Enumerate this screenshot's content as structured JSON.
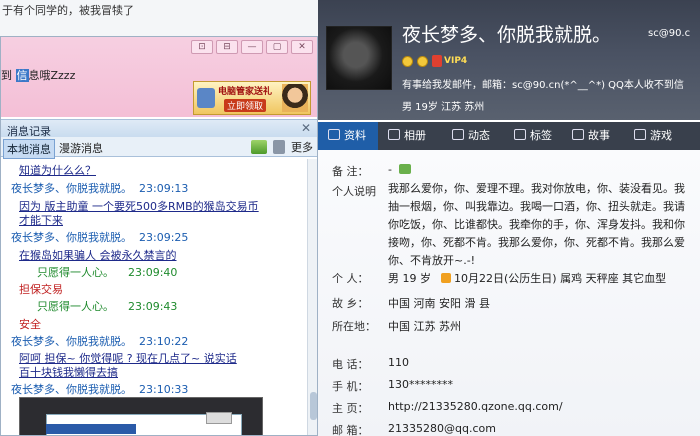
{
  "background_window": {
    "text": "于有个同学的，被我冒犊了"
  },
  "chat": {
    "window_buttons": [
      "⊡",
      "⊟",
      "—",
      "▢",
      "✕"
    ],
    "input_text_prefix": "到 ",
    "input_text_highlight": "信",
    "input_text_suffix": "息哦Zzzz",
    "ad": {
      "line1": "电脑管家送礼",
      "line2": "立即领取"
    }
  },
  "history": {
    "title": "消息记录",
    "close": "✕",
    "tab_local": "本地消息",
    "tab_roam": "漫游消息",
    "more": "更多",
    "messages": [
      {
        "type": "content",
        "text": "知道为什么么？"
      },
      {
        "type": "sender",
        "name": "夜长梦多、你脱我就脱。",
        "time": "23:09:13"
      },
      {
        "type": "content",
        "text": "因为    版主助童    一个要死500多RMB的猴岛交易币"
      },
      {
        "type": "content",
        "text": "才能下来"
      },
      {
        "type": "sender",
        "name": "夜长梦多、你脱我就脱。",
        "time": "23:09:25"
      },
      {
        "type": "content",
        "text": "在猴岛如果骗人    会被永久禁言的"
      },
      {
        "type": "me",
        "name": "只愿得一人心。",
        "time": "23:09:40"
      },
      {
        "type": "content2",
        "text": "担保交易"
      },
      {
        "type": "me",
        "name": "只愿得一人心。",
        "time": "23:09:43"
      },
      {
        "type": "content2",
        "text": "安全"
      },
      {
        "type": "sender",
        "name": "夜长梦多、你脱我就脱。",
        "time": "23:10:22"
      },
      {
        "type": "content",
        "text": "阿呵    担保~  你觉得呢  ?    现在几点了~  说实话"
      },
      {
        "type": "content",
        "text": "百十块钱我懒得去搞"
      },
      {
        "type": "sender",
        "name": "夜长梦多、你脱我就脱。",
        "time": "23:10:33"
      }
    ],
    "thumb": {
      "button": "搜索",
      "tab": "帐子"
    }
  },
  "profile": {
    "nickname": "夜长梦多、你脱我就脱。",
    "qq_partial": "sc@90.c",
    "vip": "VIP4",
    "signature": "有事给我发邮件，邮箱：sc@90.cn(*^__^*) QQ本人收不到信",
    "basic": "男    19岁    江苏 苏州",
    "tabs": [
      "资料",
      "相册",
      "动态",
      "标签",
      "故事",
      "游戏"
    ],
    "fields": {
      "note_label": "备    注：",
      "note_value": "-",
      "about_label": "个人说明",
      "about_text": "我那么爱你，你、爱理不理。我对你放电，你、装没看见。我抽一根烟，你、叫我靠边。我喝一口酒，你、扭头就走。我请你吃饭，你、比谁都快。我牵你的手，你、浑身发抖。我和你接吻，你、死都不肯。我那么爱你，你、死都不肯。我那么爱你、不肯放开~.-!",
      "person_label": "个    人：",
      "person_value_a": "男    19 岁",
      "person_value_b": "10月22日(公历生日)    属鸡    天秤座    其它血型",
      "hometown_label": "故    乡：",
      "hometown_value": "中国 河南 安阳 滑    县",
      "location_label": "所在地：",
      "location_value": "中国 江苏 苏州",
      "phone_label": "电    话：",
      "phone_value": "110",
      "mobile_label": "手    机：",
      "mobile_value": "130********",
      "home_label": "主    页：",
      "home_value": "http://21335280.qzone.qq.com/",
      "mail_label": "邮    箱：",
      "mail_value": "21335280@qq.com"
    }
  },
  "colors": {
    "profile_head": "#4a5263",
    "tab_active": "#1f5ea8",
    "chat_pink": "#f4bfd6",
    "sender_blue": "#1b5db0",
    "me_green": "#1e8a2c",
    "content_navy": "#1e2a8a",
    "content_red": "#c02020"
  }
}
